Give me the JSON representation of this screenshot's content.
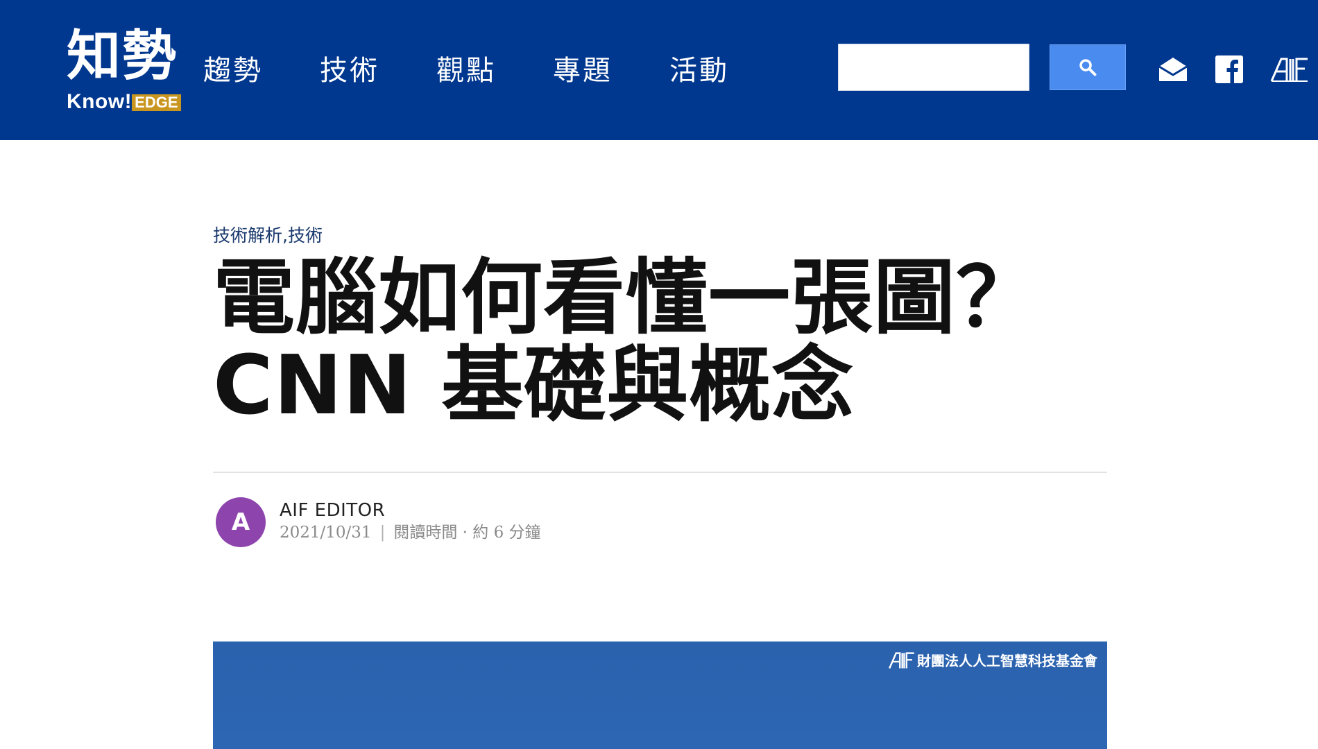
{
  "header": {
    "logo_cn": "知勢",
    "logo_know": "Know!",
    "logo_edge": "EDGE",
    "nav": [
      {
        "label": "趨勢"
      },
      {
        "label": "技術"
      },
      {
        "label": "觀點"
      },
      {
        "label": "專題"
      },
      {
        "label": "活動"
      }
    ],
    "search": {
      "value": "",
      "placeholder": ""
    },
    "icons": [
      "search-icon",
      "mail-icon",
      "facebook-icon",
      "aif-logo-icon"
    ],
    "bg_color": "#00378f",
    "button_color": "#4a8bf0"
  },
  "article": {
    "category": "技術解析,技術",
    "title_line1": "電腦如何看懂一張圖？",
    "title_line2": "CNN 基礎與概念",
    "author": {
      "initial": "A",
      "name": "AIF EDITOR",
      "avatar_color": "#8e44ad"
    },
    "date": "2021/10/31",
    "reading_time": "閱讀時間 · 約 6 分鐘"
  },
  "hero": {
    "org_name": "財團法人人工智慧科技基金會",
    "bg_color": "#2b62ae"
  }
}
